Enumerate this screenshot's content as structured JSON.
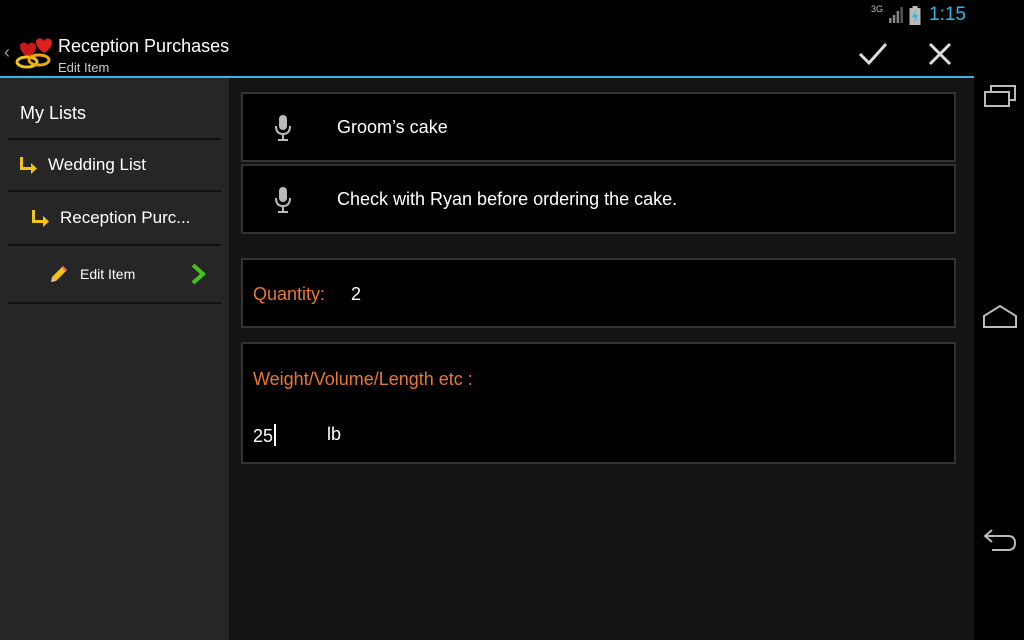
{
  "status_bar": {
    "network": "3G",
    "time": "1:15"
  },
  "action_bar": {
    "title": "Reception Purchases",
    "subtitle": "Edit Item"
  },
  "sidebar": {
    "items": [
      {
        "label": "My Lists"
      },
      {
        "label": "Wedding List"
      },
      {
        "label": "Reception Purc..."
      },
      {
        "label": "Edit Item"
      }
    ]
  },
  "form": {
    "name": "Groom’s cake",
    "notes": "Check with Ryan before ordering the cake.",
    "quantity_label": "Quantity:",
    "quantity_value": "2",
    "weight_label": "Weight/Volume/Length etc :",
    "weight_value": "25",
    "weight_unit": "lb"
  },
  "colors": {
    "accent": "#33b5e5",
    "label_orange": "#e8782f",
    "arrow_yellow": "#f0c419",
    "chevron_green": "#44c21a"
  }
}
